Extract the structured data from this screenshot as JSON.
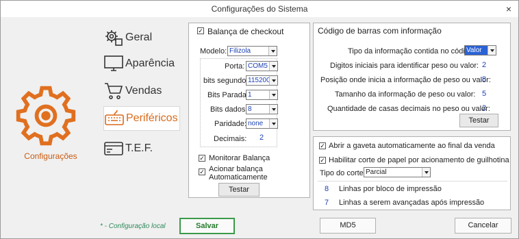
{
  "window": {
    "title": "Configurações do Sistema",
    "close": "×"
  },
  "sidebar": {
    "section_label": "Configurações",
    "items": [
      {
        "label": "Geral",
        "icon": "gear-cog-icon",
        "active": false
      },
      {
        "label": "Aparência",
        "icon": "monitor-icon",
        "active": false
      },
      {
        "label": "Vendas",
        "icon": "cart-icon",
        "active": false
      },
      {
        "label": "Periféricos",
        "icon": "keyboard-icon",
        "active": true
      },
      {
        "label": "T.E.F.",
        "icon": "card-icon",
        "active": false
      }
    ]
  },
  "balanca": {
    "checkbox_label": "Balança de checkout",
    "checked": true,
    "modelo_label": "Modelo:",
    "modelo_value": "Filizola",
    "porta_label": "Porta:",
    "porta_value": "COM5",
    "bits_segundo_label": "bits segundo:",
    "bits_segundo_value": "115200",
    "bits_parada_label": "Bits Parada:",
    "bits_parada_value": "1",
    "bits_dados_label": "Bits dados:",
    "bits_dados_value": "8",
    "paridade_label": "Paridade:",
    "paridade_value": "none",
    "decimais_label": "Decimais:",
    "decimais_value": "2",
    "monitorar_label": "Monitorar Balança",
    "monitorar_checked": true,
    "acionar_label_1": "Acionar balança",
    "acionar_label_2": "Automaticamente",
    "acionar_checked": true,
    "testar_label": "Testar"
  },
  "codigo_barras": {
    "title": "Código de barras com informação",
    "tipo_label": "Tipo da informação contida no código:",
    "tipo_value": "Valor",
    "digitos_label": "Digitos iniciais para identificar peso ou valor:",
    "digitos_value": "2",
    "posicao_label": "Posição onde inicia a informação de peso ou valor:",
    "posicao_value": "8",
    "tamanho_label": "Tamanho da informação de peso ou valor:",
    "tamanho_value": "5",
    "casas_label": "Quantidade de casas decimais no peso ou valor:",
    "casas_value": "2",
    "testar_label": "Testar"
  },
  "impressao": {
    "gaveta_label": "Abrir a gaveta automaticamente ao final da venda",
    "gaveta_checked": true,
    "guilhotina_label": "Habilitar corte de papel por acionamento de guilhotina",
    "guilhotina_checked": true,
    "tipo_corte_label": "Tipo do corte:",
    "tipo_corte_value": "Parcial",
    "linhas_bloco_value": "8",
    "linhas_bloco_label": "Linhas por bloco de impressão",
    "linhas_avanco_value": "7",
    "linhas_avanco_label": "Linhas a serem avançadas após impressão"
  },
  "footer": {
    "note": "* - Configuração local",
    "salvar": "Salvar",
    "md5": "MD5",
    "cancelar": "Cancelar"
  },
  "colors": {
    "accent": "#e07020",
    "save_border": "#3a9a4a",
    "value_text": "#1a3fb0"
  }
}
